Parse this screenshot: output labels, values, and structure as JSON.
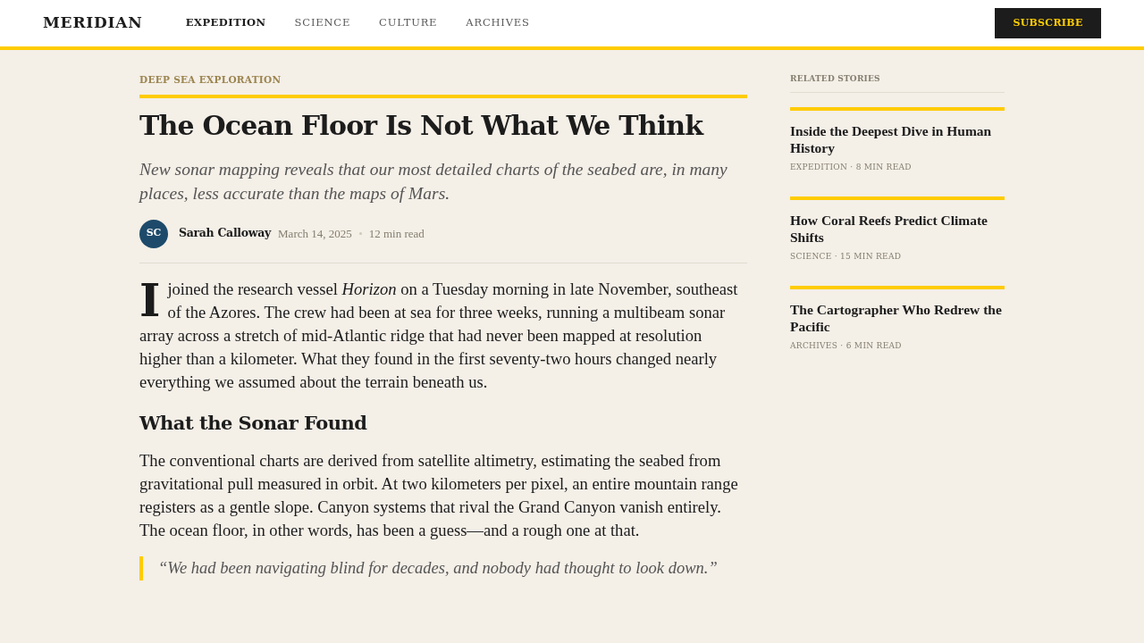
{
  "header": {
    "logo": "MERIDIAN",
    "nav": [
      {
        "label": "EXPEDITION",
        "selected": true
      },
      {
        "label": "SCIENCE",
        "selected": false
      },
      {
        "label": "CULTURE",
        "selected": false
      },
      {
        "label": "ARCHIVES",
        "selected": false
      }
    ],
    "subscribe_button": "SUBSCRIBE"
  },
  "article": {
    "kicker": "DEEP SEA EXPLORATION",
    "title": "The Ocean Floor Is Not What We Think",
    "dek": "New sonar mapping reveals that our most detailed charts of the seabed are, in many places, less accurate than the maps of Mars.",
    "byline": {
      "avatar_initials": "SC",
      "author": "Sarah Calloway",
      "date": "March 14, 2025",
      "read_time": "12 min read"
    },
    "body": [
      {
        "kind": "paragraph",
        "drop_cap": true,
        "text": "I joined the research vessel *Horizon* on a Tuesday morning in late November, southeast of the Azores. The crew had been at sea for three weeks, running a multibeam sonar array across a stretch of mid-Atlantic ridge that had never been mapped at resolution higher than a kilometer. What they found in the first seventy-two hours changed nearly everything we assumed about the terrain beneath us."
      },
      {
        "kind": "heading",
        "text": "What the Sonar Found"
      },
      {
        "kind": "paragraph",
        "drop_cap": false,
        "text": "The conventional charts are derived from satellite altimetry, estimating the seabed from gravitational pull measured in orbit. At two kilometers per pixel, an entire mountain range registers as a gentle slope. Canyon systems that rival the Grand Canyon vanish entirely. The ocean floor, in other words, has been a guess—and a rough one at that."
      },
      {
        "kind": "quote",
        "text": "“We had been navigating blind for decades, and nobody had thought to look down.”"
      }
    ]
  },
  "sidebar": {
    "heading": "RELATED STORIES",
    "stories": [
      {
        "title": "Inside the Deepest Dive in Human History",
        "meta": "EXPEDITION · 8 MIN READ"
      },
      {
        "title": "How Coral Reefs Predict Climate Shifts",
        "meta": "SCIENCE · 15 MIN READ"
      },
      {
        "title": "The Cartographer Who Redrew the Pacific",
        "meta": "ARCHIVES · 6 MIN READ"
      }
    ]
  }
}
